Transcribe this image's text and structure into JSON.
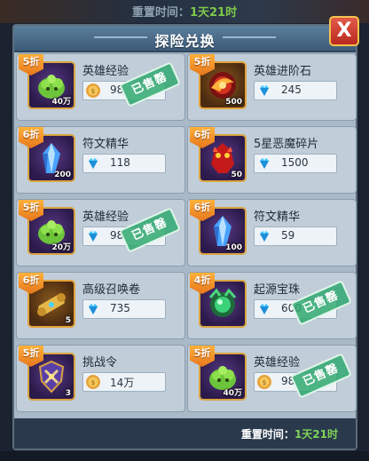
{
  "background": {
    "refresh_label": "重置时间：",
    "refresh_value": "1天21时"
  },
  "panel": {
    "title": "探险兑换",
    "close_label": "X",
    "sold_label": "已售罄",
    "footer": {
      "refresh_label": "重置时间：",
      "refresh_value": "1天21时"
    }
  },
  "items": [
    {
      "discount": "5折",
      "name": "英雄经验",
      "quantity": "40万",
      "price": "98",
      "currency": "gold-coin-icon",
      "sold_out": true,
      "icon": "green-slime-icon"
    },
    {
      "discount": "5折",
      "name": "英雄进阶石",
      "quantity": "500",
      "price": "245",
      "currency": "diamond-icon",
      "sold_out": false,
      "icon": "red-phoenix-stone-icon"
    },
    {
      "discount": "6折",
      "name": "符文精华",
      "quantity": "200",
      "price": "118",
      "currency": "diamond-icon",
      "sold_out": false,
      "icon": "blue-crystal-icon"
    },
    {
      "discount": "6折",
      "name": "5星恶魔碎片",
      "quantity": "50",
      "price": "1500",
      "currency": "diamond-icon",
      "sold_out": false,
      "icon": "demon-shard-icon"
    },
    {
      "discount": "5折",
      "name": "英雄经验",
      "quantity": "20万",
      "price": "98",
      "currency": "diamond-icon",
      "sold_out": true,
      "icon": "green-slime-icon"
    },
    {
      "discount": "6折",
      "name": "符文精华",
      "quantity": "100",
      "price": "59",
      "currency": "diamond-icon",
      "sold_out": false,
      "icon": "blue-crystal-icon"
    },
    {
      "discount": "6折",
      "name": "高级召唤卷",
      "quantity": "5",
      "price": "735",
      "currency": "diamond-icon",
      "sold_out": false,
      "icon": "summon-scroll-icon"
    },
    {
      "discount": "4折",
      "name": "起源宝珠",
      "quantity": "",
      "price": "600",
      "currency": "diamond-icon",
      "sold_out": true,
      "icon": "origin-orb-icon"
    },
    {
      "discount": "5折",
      "name": "挑战令",
      "quantity": "3",
      "price": "14万",
      "currency": "gold-coin-icon",
      "sold_out": false,
      "icon": "challenge-token-icon"
    },
    {
      "discount": "5折",
      "name": "英雄经验",
      "quantity": "40万",
      "price": "98",
      "currency": "gold-coin-icon",
      "sold_out": true,
      "icon": "green-slime-icon"
    }
  ],
  "colors": {
    "badge": "#f39a2b",
    "sold_stamp": "#30a870",
    "highlight_time": "#7fd35a",
    "close_button": "#d0392b"
  }
}
